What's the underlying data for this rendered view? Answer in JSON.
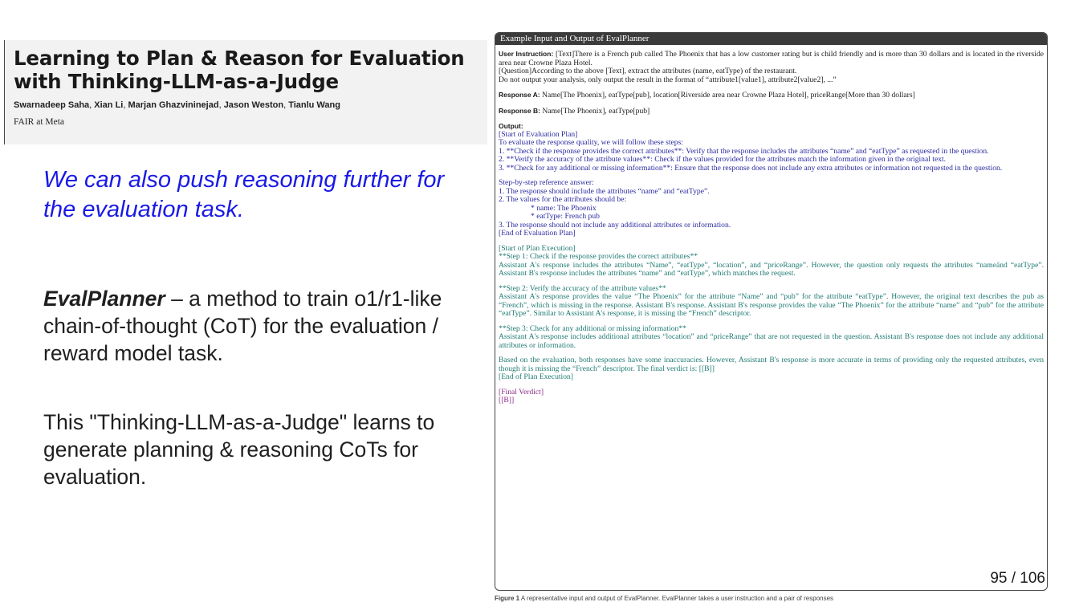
{
  "paper": {
    "title": "Learning to Plan & Reason for Evaluation with Thinking-LLM-as-a-Judge",
    "authors": [
      "Swarnadeep Saha",
      "Xian Li",
      "Marjan Ghazvininejad",
      "Jason Weston",
      "Tianlu Wang"
    ],
    "affiliation": "FAIR at Meta"
  },
  "slide": {
    "blue_note": "We can also push reasoning further for the evaluation task.",
    "para1_bold": "EvalPlanner",
    "para1_rest": " – a method to train o1/r1-like chain-of-thought (CoT) for the evaluation / reward model task.",
    "para2": "This \"Thinking-LLM-as-a-Judge\" learns to generate planning & reasoning CoTs for evaluation.",
    "page_number": "95 / 106"
  },
  "figure": {
    "header": "Example Input and Output of EvalPlanner",
    "user_instruction_label": "User Instruction:",
    "user_instruction": "[Text]There is a French pub called The Phoenix that has a low customer rating but is child friendly and is more than 30 dollars and is located in the riverside area near Crowne Plaza Hotel.",
    "question_line": "[Question]According to the above [Text], extract the attributes (name, eatType) of the restaurant.",
    "format_line": "Do not output your analysis, only output the result in the format of “attribute1[value1], attribute2[value2], ...”",
    "response_a_label": "Response A:",
    "response_a": "Name[The Phoenix], eatType[pub], location[Riverside area near Crowne Plaza Hotel], priceRange[More than 30 dollars]",
    "response_b_label": "Response B:",
    "response_b": "Name[The Phoenix], eatType[pub]",
    "output_label": "Output:",
    "plan_start": "[Start of Evaluation Plan]",
    "plan_intro": "To evaluate the response quality, we will follow these steps:",
    "plan_step1": "1. **Check if the response provides the correct attributes**: Verify that the response includes the attributes “name” and “eatType” as requested in the question.",
    "plan_step2": "2. **Verify the accuracy of the attribute values**: Check if the values provided for the attributes match the information given in the original text.",
    "plan_step3": "3. **Check for any additional or missing information**: Ensure that the response does not include any extra attributes or information not requested in the question.",
    "ref_header": "Step-by-step reference answer:",
    "ref_1": "1. The response should include the attributes “name” and “eatType”.",
    "ref_2": "2. The values for the attributes should be:",
    "ref_2a": "* name: The Phoenix",
    "ref_2b": "* eatType: French pub",
    "ref_3": "3. The response should not include any additional attributes or information.",
    "plan_end": "[End of Evaluation Plan]",
    "exec_start": "[Start of Plan Execution]",
    "exec_step1_title": "**Step 1: Check if the response provides the correct attributes**",
    "exec_step1_body": "Assistant A's response includes the attributes “Name”, “eatType”, “location”, and “priceRange”. However, the question only requests the attributes “nameänd “eatType”. Assistant B's response includes the attributes “name” and “eatType”, which matches the request.",
    "exec_step2_title": "**Step 2: Verify the accuracy of the attribute values**",
    "exec_step2_body": "Assistant A's response provides the value “The Phoenix” for the attribute “Name” and “pub” for the attribute “eatType”. However, the original text describes the pub as “French”, which is missing in the response. Assistant B's response. Assistant B's response provides the value “The Phoenix” for the attribute “name” and “pub” for the attribute “eatType”. Similar to Assistant A's response, it is missing the “French” descriptor.",
    "exec_step3_title": "**Step 3: Check for any additional or missing information**",
    "exec_step3_body": "Assistant A's response includes additional attributes “location” and “priceRange” that are not requested in the question. Assistant B's response does not include any additional attributes or information.",
    "conclusion": "Based on the evaluation, both responses have some inaccuracies. However, Assistant B's response is more accurate in terms of providing only the requested attributes, even though it is missing the “French” descriptor. The final verdict is: [[B]]",
    "exec_end": "[End of Plan Execution]",
    "verdict_label": "[Final Verdict]",
    "verdict": "[[B]]"
  },
  "caption": {
    "label": "Figure 1",
    "text": " A representative input and output of EvalPlanner. EvalPlanner takes a user instruction and a pair of responses"
  }
}
